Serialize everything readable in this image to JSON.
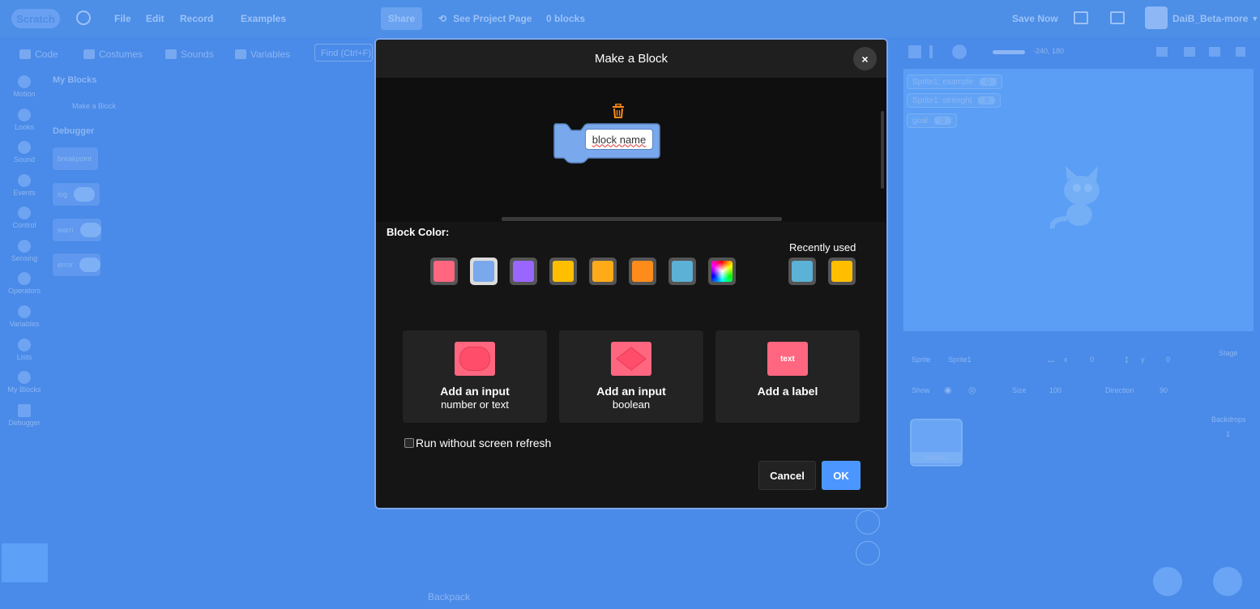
{
  "menubar": {
    "logo": "Scratch",
    "file": "File",
    "edit": "Edit",
    "record": "Record",
    "project_title": "Examples",
    "share": "Share",
    "see_project_page": "See Project Page",
    "block_count": "0 blocks",
    "save_now": "Save Now",
    "username": "DaiB_Beta-more"
  },
  "tabs": {
    "code": "Code",
    "costumes": "Costumes",
    "sounds": "Sounds",
    "variables": "Variables",
    "find_placeholder": "Find (Ctrl+F)"
  },
  "categories": [
    "Motion",
    "Looks",
    "Sound",
    "Events",
    "Control",
    "Sensing",
    "Operators",
    "Variables",
    "Lists",
    "My Blocks",
    "Debugger"
  ],
  "palette": {
    "my_blocks_heading": "My Blocks",
    "make_a_block": "Make a Block",
    "debugger_heading": "Debugger",
    "blocks": [
      "breakpoint",
      "log",
      "warn",
      "error"
    ]
  },
  "stage": {
    "coords": "-240, 180",
    "monitors": [
      {
        "label": "Sprite1: example",
        "value": "0"
      },
      {
        "label": "Sprite1: strenght",
        "value": "0"
      },
      {
        "label": "goal",
        "value": "0"
      }
    ]
  },
  "sprite_info": {
    "sprite_label": "Sprite",
    "sprite_name": "Sprite1",
    "x_label": "x",
    "x_value": "0",
    "y_label": "y",
    "y_value": "0",
    "show_label": "Show",
    "size_label": "Size",
    "size_value": "100",
    "direction_label": "Direction",
    "direction_value": "90",
    "stage_label": "Stage",
    "backdrops_label": "Backdrops",
    "backdrops_count": "1",
    "thumb_label": "Sprite1"
  },
  "backpack": "Backpack",
  "modal": {
    "title": "Make a Block",
    "close_glyph": "×",
    "block_name": "block name",
    "block_color_label": "Block Color:",
    "recently_used_label": "Recently used",
    "colors": [
      "#ff6680",
      "#7aa8ec",
      "#9966ff",
      "#ffbf00",
      "#ffab19",
      "#ff8c1a",
      "#5cb1d6",
      "rainbow"
    ],
    "selected_color_index": 1,
    "recent_colors": [
      "#5cb1d6",
      "#ffbf00"
    ],
    "options": [
      {
        "title": "Add an input",
        "subtitle": "number or text",
        "icon": "oval-input-icon"
      },
      {
        "title": "Add an input",
        "subtitle": "boolean",
        "icon": "hexagon-input-icon"
      },
      {
        "title": "Add a label",
        "subtitle": "",
        "icon": "text-label-icon",
        "icon_text": "text"
      }
    ],
    "run_without_refresh": "Run without screen refresh",
    "run_without_refresh_checked": false,
    "cancel": "Cancel",
    "ok": "OK"
  }
}
